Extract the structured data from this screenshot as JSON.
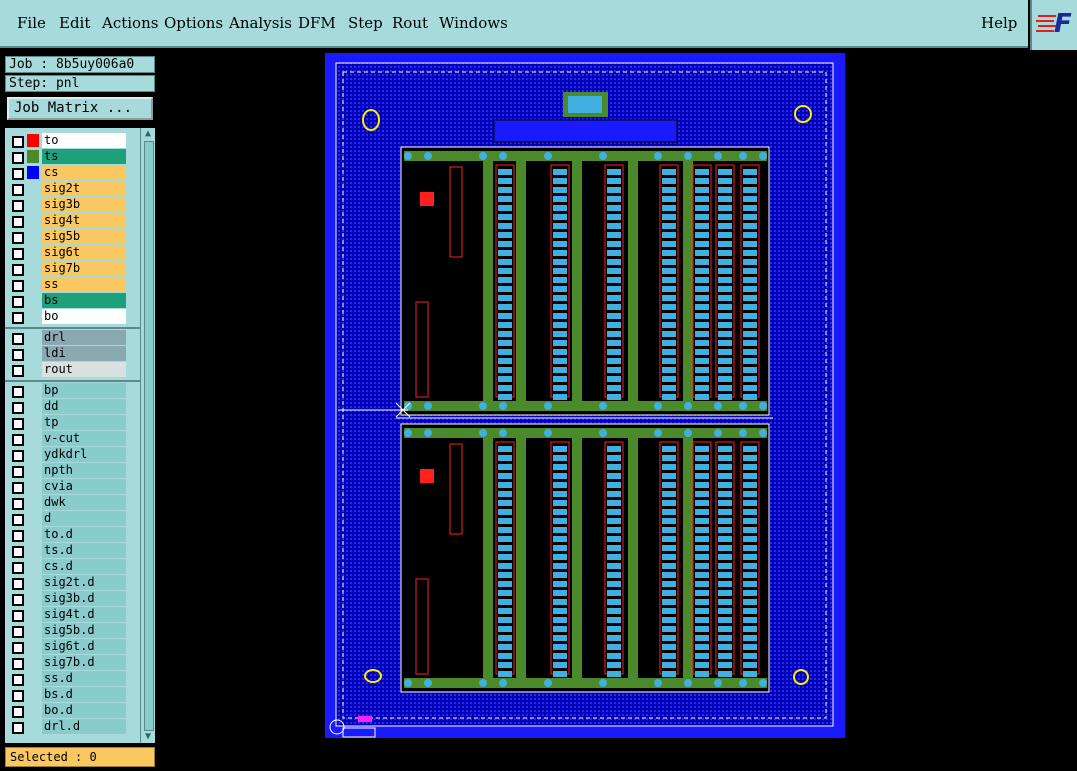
{
  "menu": {
    "items": [
      "File",
      "Edit",
      "Actions",
      "Options",
      "Analysis",
      "DFM",
      "Step",
      "Rout",
      "Windows"
    ],
    "help": "Help"
  },
  "logo": {
    "text": "F"
  },
  "info": {
    "job": "Job : 8b5uy006a0",
    "step": "Step: pnl"
  },
  "job_matrix_label": "Job Matrix ...",
  "layers_group1": [
    {
      "name": "to",
      "bg": "#ffffff",
      "swatch": "#ff0000",
      "pre": "#0000ff"
    },
    {
      "name": "ts",
      "bg": "#1ea07a",
      "swatch": "#4a8a2a"
    },
    {
      "name": "cs",
      "bg": "#f9c860",
      "swatch": "#0000ff"
    },
    {
      "name": "sig2t",
      "bg": "#f9c860"
    },
    {
      "name": "sig3b",
      "bg": "#f9c860"
    },
    {
      "name": "sig4t",
      "bg": "#f9c860"
    },
    {
      "name": "sig5b",
      "bg": "#f9c860"
    },
    {
      "name": "sig6t",
      "bg": "#f9c860"
    },
    {
      "name": "sig7b",
      "bg": "#f9c860"
    },
    {
      "name": "ss",
      "bg": "#f9c860"
    },
    {
      "name": "bs",
      "bg": "#1ea07a"
    },
    {
      "name": "bo",
      "bg": "#ffffff"
    }
  ],
  "layers_group2": [
    {
      "name": "drl",
      "bg": "#8aa8b0"
    },
    {
      "name": "ldi",
      "bg": "#8aa8b0"
    },
    {
      "name": "rout",
      "bg": "#d8e0e0"
    }
  ],
  "layers_group3": [
    {
      "name": "bp",
      "bg": "#8acccc"
    },
    {
      "name": "dd",
      "bg": "#8acccc"
    },
    {
      "name": "tp",
      "bg": "#8acccc"
    },
    {
      "name": "v-cut",
      "bg": "#8acccc"
    },
    {
      "name": "ydkdrl",
      "bg": "#8acccc"
    },
    {
      "name": "npth",
      "bg": "#8acccc"
    },
    {
      "name": "cvia",
      "bg": "#8acccc"
    },
    {
      "name": "dwk",
      "bg": "#8acccc"
    },
    {
      "name": "d",
      "bg": "#8acccc"
    },
    {
      "name": "to.d",
      "bg": "#8acccc"
    },
    {
      "name": "ts.d",
      "bg": "#8acccc"
    },
    {
      "name": "cs.d",
      "bg": "#8acccc"
    },
    {
      "name": "sig2t.d",
      "bg": "#8acccc"
    },
    {
      "name": "sig3b.d",
      "bg": "#8acccc"
    },
    {
      "name": "sig4t.d",
      "bg": "#8acccc"
    },
    {
      "name": "sig5b.d",
      "bg": "#8acccc"
    },
    {
      "name": "sig6t.d",
      "bg": "#8acccc"
    },
    {
      "name": "sig7b.d",
      "bg": "#8acccc"
    },
    {
      "name": "ss.d",
      "bg": "#8acccc"
    },
    {
      "name": "bs.d",
      "bg": "#8acccc"
    },
    {
      "name": "bo.d",
      "bg": "#8acccc"
    },
    {
      "name": "drl.d",
      "bg": "#8acccc"
    }
  ],
  "selected": "Selected : 0",
  "colors": {
    "panel": "#a7dada",
    "board": "#0000d0",
    "frame": "#1a1aff",
    "rail": "#4a8a2a",
    "pad": "#40b0e0",
    "trace": "#ff2020"
  }
}
